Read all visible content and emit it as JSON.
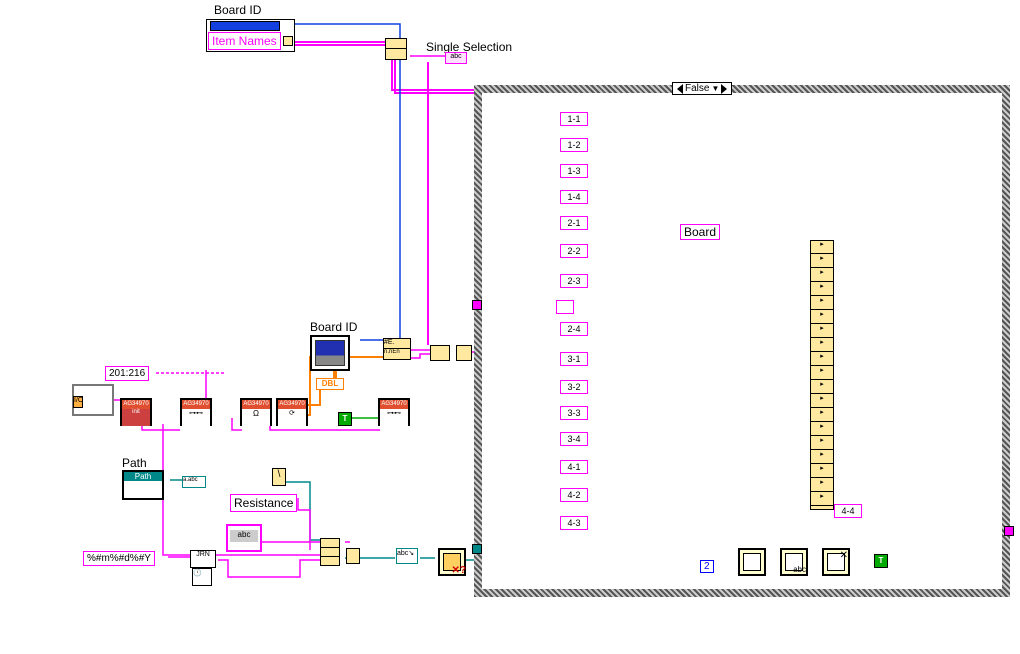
{
  "header": {
    "board_id_top": "Board ID",
    "item_names": "Item Names",
    "single_selection": "Single Selection"
  },
  "mid": {
    "board_id_chart": "Board ID",
    "dbl": "DBL",
    "range_const": "201:216",
    "path": "Path",
    "path_glyph": "Path",
    "resistance": "Resistance",
    "format_str": "%#m%#d%#Y",
    "true_const_1": "T",
    "true_const_2": "T",
    "abc": "abc",
    "jrn": "JRN",
    "num2": "2"
  },
  "case": {
    "selector": "False",
    "board_label": "Board",
    "cluster_alt": "4-4",
    "pins": [
      "1-1",
      "1-2",
      "1-3",
      "1-4",
      "2-1",
      "2-2",
      "2-3",
      "",
      "2-4",
      "3-1",
      "3-2",
      "3-3",
      "3-4",
      "4-1",
      "4-2",
      "4-3"
    ]
  },
  "colors": {
    "pink": "#ff00ff",
    "orange": "#ff8000",
    "blue": "#1040e0",
    "teal": "#008080",
    "green": "#00aa00"
  }
}
